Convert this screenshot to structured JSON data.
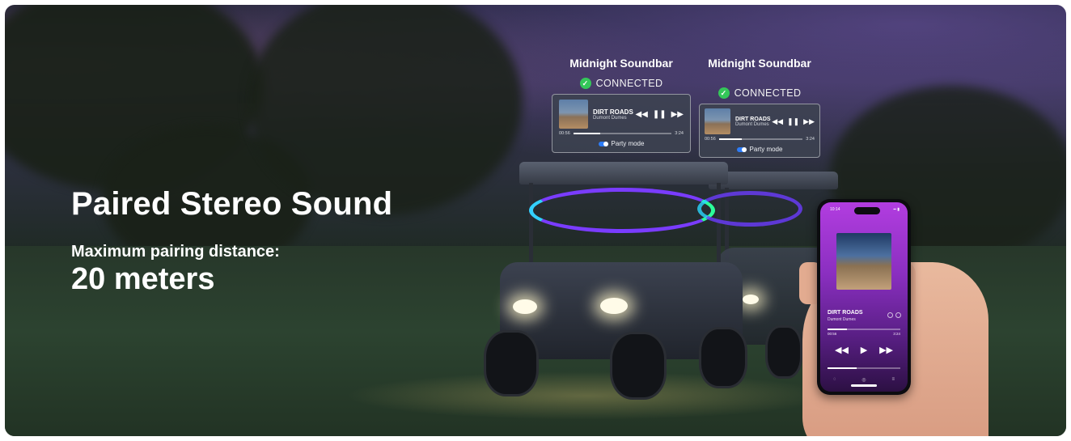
{
  "hero": {
    "heading": "Paired Stereo Sound",
    "subheading": "Maximum pairing distance:",
    "distance": "20 meters"
  },
  "devices": [
    {
      "name": "Midnight Soundbar",
      "status": "CONNECTED",
      "track": "DIRT ROADS",
      "artist": "Dumont Dumes",
      "elapsed": "00:56",
      "duration": "3:24",
      "progress": 0.27,
      "party_mode_label": "Party mode",
      "party_mode_on": true
    },
    {
      "name": "Midnight Soundbar",
      "status": "CONNECTED",
      "track": "DIRT ROADS",
      "artist": "Dumont Dumes",
      "elapsed": "00:56",
      "duration": "3:24",
      "progress": 0.27,
      "party_mode_label": "Party mode",
      "party_mode_on": true
    }
  ],
  "phone": {
    "time": "10:14",
    "track": "DIRT ROADS",
    "artist": "Dumont Dumes",
    "elapsed": "00:56",
    "duration": "3:24",
    "progress": 0.27,
    "volume": 0.4
  },
  "colors": {
    "connected": "#34c759",
    "toggle": "#2d7cf6",
    "phone_gradient_top": "#b23de0",
    "phone_gradient_bottom": "#2c1043"
  },
  "icons": {
    "connected": "check-circle-icon",
    "rewind": "rewind-icon",
    "pause": "pause-icon",
    "play": "play-icon",
    "forward": "fast-forward-icon"
  }
}
